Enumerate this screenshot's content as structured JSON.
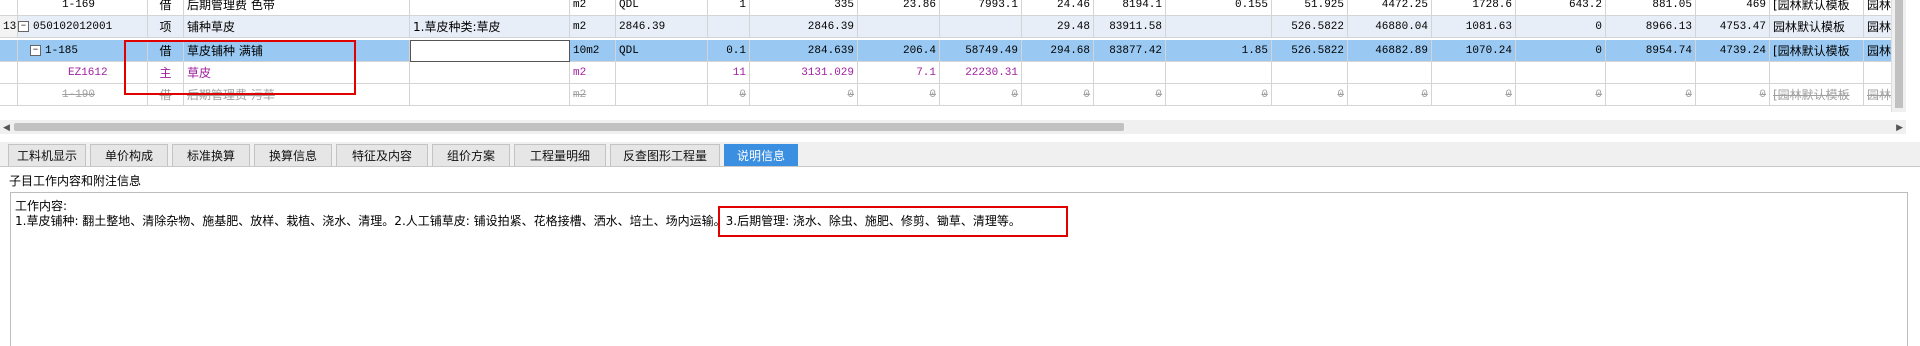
{
  "grid": {
    "rows": [
      {
        "seq": "",
        "code": "1-169",
        "type": "借",
        "name": "后期管理费 色带",
        "feature": "",
        "unit": "m2",
        "expr": "QDL",
        "qty": "1",
        "qty2": "335",
        "price": "23.86",
        "total": "7993.1",
        "c1": "24.46",
        "c2": "8194.1",
        "c3": "0.155",
        "c4": "51.925",
        "c5": "4472.25",
        "c6": "1728.6",
        "c7": "643.2",
        "c8": "881.05",
        "c9": "469",
        "c10": "[园林默认模板",
        "c11": "园林工程"
      },
      {
        "seq": "13",
        "code": "050102012001",
        "type": "项",
        "name": "铺种草皮",
        "feature": "1.草皮种类:草皮",
        "unit": "m2",
        "expr": "2846.39",
        "qty": "",
        "qty2": "2846.39",
        "price": "",
        "total": "",
        "c1": "29.48",
        "c2": "83911.58",
        "c3": "",
        "c4": "526.5822",
        "c5": "46880.04",
        "c6": "1081.63",
        "c7": "0",
        "c8": "8966.13",
        "c9": "4753.47",
        "c10": "园林默认模板",
        "c11": "园林绿化"
      },
      {
        "seq": "",
        "code": "1-185",
        "type": "借",
        "name": "草皮铺种 满铺",
        "feature": "",
        "unit": "10m2",
        "expr": "QDL",
        "qty": "0.1",
        "qty2": "284.639",
        "price": "206.4",
        "total": "58749.49",
        "c1": "294.68",
        "c2": "83877.42",
        "c3": "1.85",
        "c4": "526.5822",
        "c5": "46882.89",
        "c6": "1070.24",
        "c7": "0",
        "c8": "8954.74",
        "c9": "4739.24",
        "c10": "[园林默认模板",
        "c11": "园林工程"
      },
      {
        "seq": "",
        "code": "EZ1612",
        "type": "主",
        "name": "草皮",
        "feature": "",
        "unit": "m2",
        "expr": "",
        "qty": "11",
        "qty2": "3131.029",
        "price": "7.1",
        "total": "22230.31",
        "c1": "",
        "c2": "",
        "c3": "",
        "c4": "",
        "c5": "",
        "c6": "",
        "c7": "",
        "c8": "",
        "c9": "",
        "c10": "",
        "c11": ""
      },
      {
        "seq": "",
        "code": "1-190",
        "type": "借",
        "name": "后期管理费 污草",
        "feature": "",
        "unit": "m2",
        "expr": "",
        "qty": "0",
        "qty2": "0",
        "price": "0",
        "total": "0",
        "c1": "0",
        "c2": "0",
        "c3": "0",
        "c4": "0",
        "c5": "0",
        "c6": "0",
        "c7": "0",
        "c8": "0",
        "c9": "0",
        "c10": "[园林默认模板",
        "c11": "园林工程"
      }
    ]
  },
  "tabs": [
    {
      "label": "工料机显示"
    },
    {
      "label": "单价构成"
    },
    {
      "label": "标准换算"
    },
    {
      "label": "换算信息"
    },
    {
      "label": "特征及内容"
    },
    {
      "label": "组价方案"
    },
    {
      "label": "工程量明细"
    },
    {
      "label": "反查图形工程量"
    },
    {
      "label": "说明信息"
    }
  ],
  "section_title": "子目工作内容和附注信息",
  "description": {
    "line1": "工作内容:",
    "line2a": "1.草皮铺种: 翻土整地、清除杂物、施基肥、放样、栽植、浇水、清理。2.人工铺草皮: 铺设拍紧、花格接槽、洒水、培土、场内运输。",
    "line2b": "3.后期管理: 浇水、除虫、施肥、修剪、锄草、清理等。"
  },
  "colors": {
    "selected_row": "#99c9f2",
    "active_tab": "#3b8fe0",
    "highlight": "#e00000",
    "main_material": "#a020a0"
  }
}
